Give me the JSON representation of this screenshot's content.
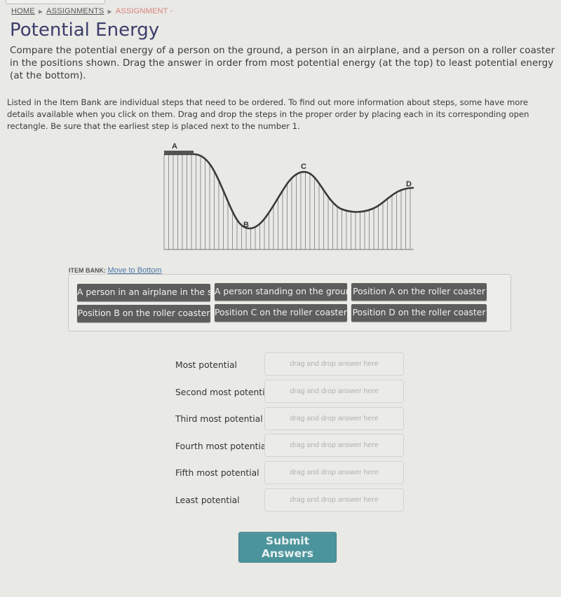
{
  "breadcrumb": {
    "home": "HOME",
    "assignments": "ASSIGNMENTS",
    "current": "ASSIGNMENT -"
  },
  "page_title": "Potential Energy",
  "prompt": "Compare the potential energy of a person on the ground, a person in an airplane, and a person on a roller coaster in the positions shown. Drag the answer in order from most potential energy (at the top) to least potential energy (at the bottom).",
  "instructions": "Listed in the Item Bank are individual steps that need to be ordered. To find out more information about steps, some have more details available when you click on them. Drag and drop the steps in the proper order by placing each in its corresponding open rectangle. Be sure that the earliest step is placed next to the number 1.",
  "figure": {
    "labels": [
      "A",
      "B",
      "C",
      "D"
    ]
  },
  "item_bank": {
    "label": "ITEM BANK:",
    "move_link": "Move to Bottom",
    "items": [
      "A person in an airplane in the sky",
      "A person standing on the ground",
      "Position A on the roller coaster",
      "Position B on the roller coaster",
      "Position C on the roller coaster",
      "Position D on the roller coaster"
    ]
  },
  "answer_slots": [
    {
      "label": "Most potential",
      "placeholder": "drag and drop answer here"
    },
    {
      "label": "Second most potential",
      "placeholder": "drag and drop answer here"
    },
    {
      "label": "Third most potential",
      "placeholder": "drag and drop answer here"
    },
    {
      "label": "Fourth most potential",
      "placeholder": "drag and drop answer here"
    },
    {
      "label": "Fifth most potential",
      "placeholder": "drag and drop answer here"
    },
    {
      "label": "Least potential",
      "placeholder": "drag and drop answer here"
    }
  ],
  "submit_label": "Submit Answers"
}
